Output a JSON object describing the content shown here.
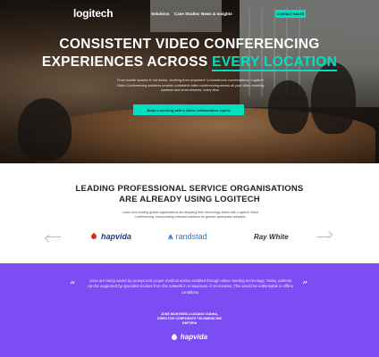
{
  "nav": {
    "logo": "logitech",
    "links": [
      "Solutions",
      "Case Studies",
      "News & Insights"
    ],
    "cta": "CONTACT SALES"
  },
  "hero": {
    "title_line1": "CONSISTENT VIDEO CONFERENCING",
    "title_line2_prefix": "EXPERIENCES ACROSS",
    "title_line2_accent": "EVERY LOCATION",
    "subtitle": "From huddle spaces to hot desks, 'working-from-anywhere' to boardroom conversations, Logitech Video Conferencing solutions provide consistent video conferencing across all your video meeting systems and environments, every time.",
    "button": "Book a meeting with a video collaboration expert"
  },
  "clients": {
    "title_line1": "LEADING PROFESSIONAL SERVICE ORGANISATIONS",
    "title_line2": "ARE ALREADY USING LOGITECH",
    "subtitle": "Learn how leading global organisations are adopting their technology suites with Logitech Video Conferencing, incorporating onboard solutions for greater workspace adoption.",
    "logos": [
      "hapvida",
      "randstad",
      "Ray White"
    ]
  },
  "testimonial": {
    "quote": "Lives are being saved by prompt and proper medical advice enabled through video meeting technology. Today, patients can be supported by specialist doctors from the network in a maximum of 10 minutes. This would be unthinkable in offline conditions.",
    "author_name": "JOSÉ MONTEIRO-LUCIANO CUNHA,",
    "author_role": "DIRECTOR CORPORATE TELEMEDICINE",
    "author_company": "HAPVIDA",
    "logo": "hapvida"
  },
  "colors": {
    "accent": "#00e1c3",
    "testimonial_bg": "#7b4df2"
  },
  "icons": [
    "arrow-left-icon",
    "arrow-right-icon",
    "quote-open-icon",
    "quote-close-icon",
    "hapvida-logo-icon",
    "randstad-logo-icon"
  ]
}
